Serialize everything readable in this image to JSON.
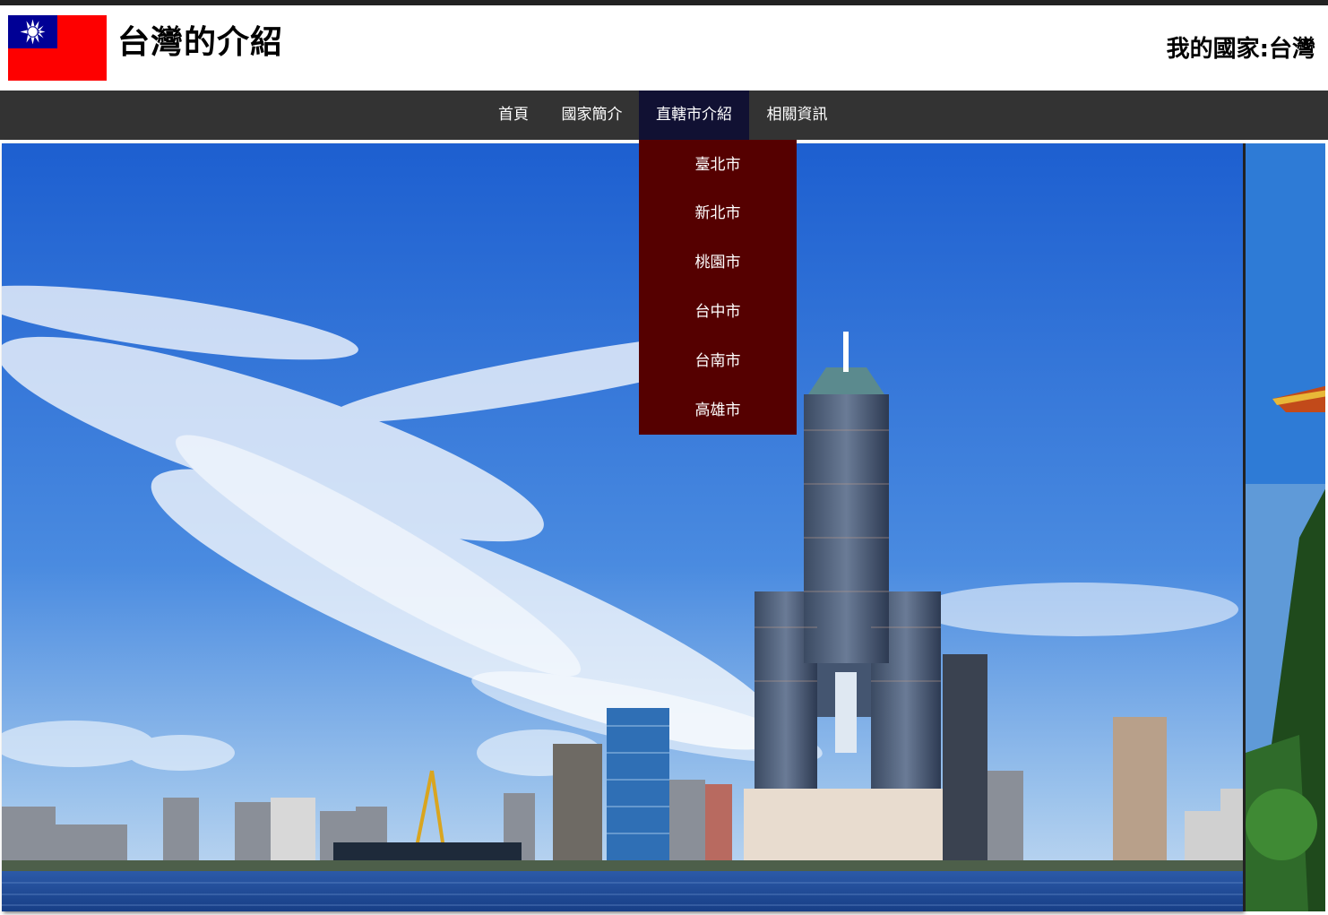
{
  "header": {
    "title": "台灣的介紹",
    "country_label": "我的國家:台灣",
    "flag_icon": "taiwan-flag-icon"
  },
  "nav": {
    "items": [
      {
        "label": "首頁"
      },
      {
        "label": "國家簡介"
      },
      {
        "label": "直轄市介紹"
      },
      {
        "label": "相關資訊"
      }
    ],
    "active_index": 2
  },
  "dropdown": {
    "items": [
      {
        "label": "臺北市"
      },
      {
        "label": "新北市"
      },
      {
        "label": "桃園市"
      },
      {
        "label": "台中市"
      },
      {
        "label": "台南市"
      },
      {
        "label": "高雄市"
      }
    ]
  },
  "slideshow": {
    "current_slide": "kaohsiung-skyline-image",
    "next_slide": "temple-garden-image"
  },
  "colors": {
    "nav_bg": "#333333",
    "nav_active_bg": "#111133",
    "dropdown_bg": "#550000",
    "flag_red": "#fe0000",
    "flag_blue": "#000095"
  }
}
